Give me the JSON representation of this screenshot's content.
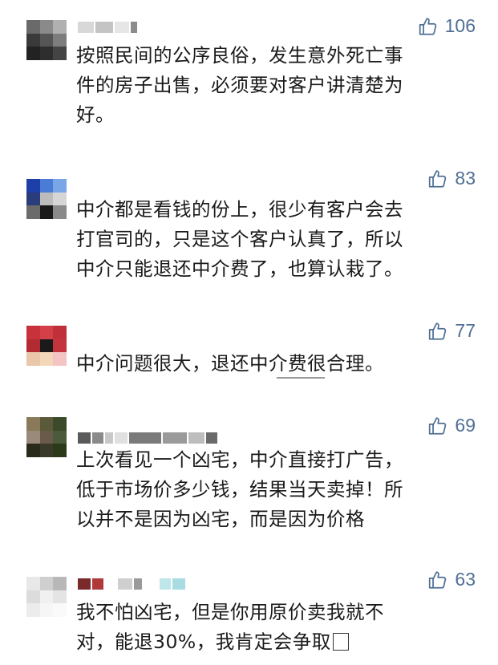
{
  "comments": [
    {
      "likes": "106",
      "lines": [
        "按照民间的公序良俗，发生意外死亡事",
        "件的房子出售，必须要对客户讲清楚为",
        "好。"
      ]
    },
    {
      "likes": "83",
      "lines": [
        "中介都是看钱的份上，很少有客户会去",
        "打官司的，只是这个客户认真了，所以",
        "中介只能退还中介费了，也算认栽了。"
      ]
    },
    {
      "likes": "77",
      "lines": [
        "中介问题很大，退还中介费很合理。"
      ]
    },
    {
      "likes": "69",
      "lines": [
        "上次看见一个凶宅，中介直接打广告，",
        "低于市场价多少钱，结果当天卖掉！所",
        "以并不是因为凶宅，而是因为价格"
      ]
    },
    {
      "likes": "63",
      "lines": [
        "我不怕凶宅，但是你用原价卖我就不",
        "对，能退30%，我肯定会争取"
      ]
    }
  ],
  "icons": {
    "like": "thumbs-up-icon"
  },
  "colors": {
    "like_accent": "#4f6f95",
    "text": "#1a1a1a"
  }
}
